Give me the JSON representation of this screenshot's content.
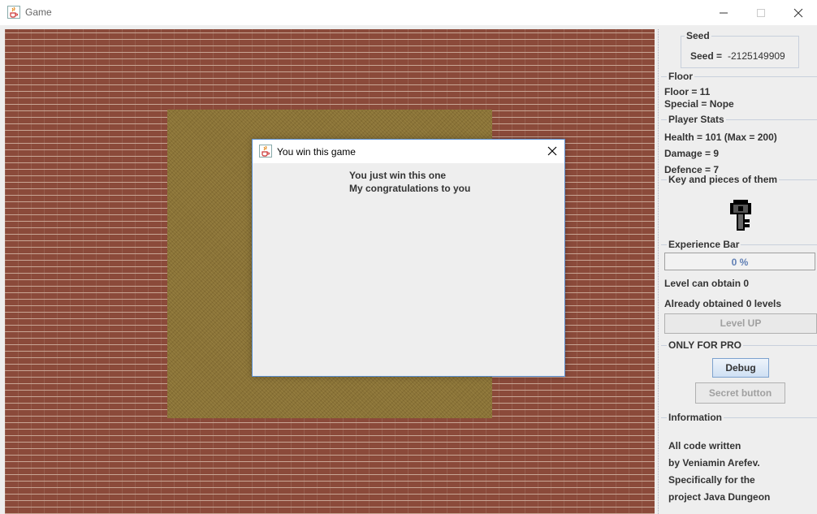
{
  "window": {
    "title": "Game"
  },
  "dialog": {
    "title": "You win this game",
    "lines": [
      "You just win this one",
      "My congratulations to you"
    ]
  },
  "sidebar": {
    "seed": {
      "title": "Seed",
      "label": "Seed =",
      "value": "-2125149909"
    },
    "floor": {
      "title": "Floor",
      "floor_text": "Floor = 11",
      "special_text": "Special = Nope"
    },
    "player_stats": {
      "title": "Player Stats",
      "health": "Health = 101 (Max = 200)",
      "damage": "Damage = 9",
      "defence": "Defence = 7"
    },
    "key": {
      "title": "Key and pieces of them",
      "icon": "key-icon"
    },
    "experience": {
      "title": "Experience Bar",
      "progress_percent": 0,
      "progress_text": "0 %",
      "level_can_obtain": "Level can obtain 0",
      "already_obtained": "Already obtained 0 levels",
      "level_up_label": "Level UP"
    },
    "pro": {
      "title": "ONLY FOR PRO",
      "debug_label": "Debug",
      "secret_label": "Secret button"
    },
    "information": {
      "title": "Information",
      "lines": [
        "All code written",
        "by Veniamin Arefev.",
        "Specifically for the",
        "project Java Dungeon"
      ]
    }
  },
  "colors": {
    "accent": "#5a8fd0",
    "wall": "#8b4a3a",
    "floor": "#8a7337"
  }
}
